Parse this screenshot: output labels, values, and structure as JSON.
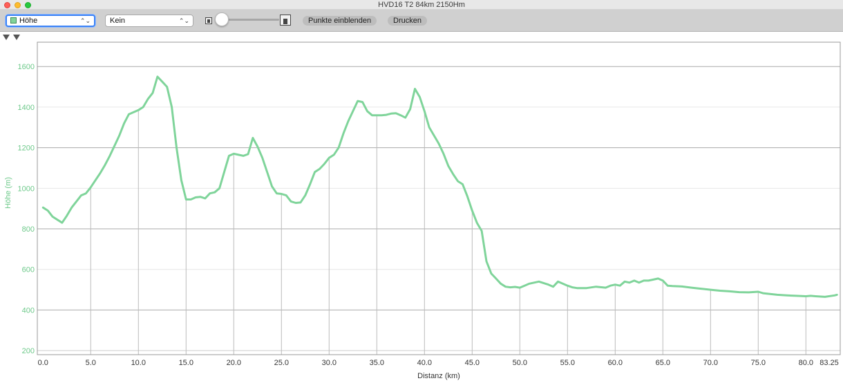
{
  "window": {
    "title": "HVD16 T2 84km 2150Hm"
  },
  "toolbar": {
    "left_select": "Höhe",
    "right_select": "Kein",
    "show_points_label": "Punkte einblenden",
    "print_label": "Drucken"
  },
  "icons": {
    "select_arrows": "⌃⌄"
  },
  "colors": {
    "series": "#7fd49a",
    "y_axis_text": "#6dc98a",
    "x_axis_text": "#333333",
    "grid": "#bbbbbb"
  },
  "chart_data": {
    "type": "line",
    "xlabel": "Distanz (km)",
    "ylabel": "Höhe (m)",
    "xlim": [
      -0.6,
      83.6
    ],
    "ylim": [
      180,
      1720
    ],
    "x_ticks": [
      0,
      5,
      10,
      15,
      20,
      25,
      30,
      35,
      40,
      45,
      50,
      55,
      60,
      65,
      70,
      75,
      80
    ],
    "x_tick_labels": [
      "0.0",
      "5.0",
      "10.0",
      "15.0",
      "20.0",
      "25.0",
      "30.0",
      "35.0",
      "40.0",
      "45.0",
      "50.0",
      "55.0",
      "60.0",
      "65.0",
      "70.0",
      "75.0",
      "80.0"
    ],
    "x_end_label": "83.25",
    "y_ticks": [
      200,
      400,
      600,
      800,
      1000,
      1200,
      1400,
      1600
    ],
    "y_tick_labels": [
      "200",
      "400",
      "600",
      "800",
      "1000",
      "1200",
      "1400",
      "1600"
    ],
    "grid": true,
    "series": [
      {
        "color": "#7fd49a",
        "x": [
          0,
          0.5,
          1,
          1.5,
          2,
          2.5,
          3,
          3.5,
          4,
          4.5,
          5,
          5.5,
          6,
          6.5,
          7,
          7.5,
          8,
          8.5,
          9,
          9.5,
          10,
          10.5,
          11,
          11.5,
          12,
          12.5,
          13,
          13.5,
          14,
          14.5,
          15,
          15.5,
          16,
          16.5,
          17,
          17.5,
          18,
          18.5,
          19,
          19.5,
          20,
          20.5,
          21,
          21.5,
          22,
          22.5,
          23,
          23.5,
          24,
          24.5,
          25,
          25.5,
          26,
          26.5,
          27,
          27.5,
          28,
          28.5,
          29,
          29.5,
          30,
          30.5,
          31,
          31.5,
          32,
          32.5,
          33,
          33.5,
          34,
          34.5,
          35,
          35.5,
          36,
          36.5,
          37,
          37.5,
          38,
          38.5,
          39,
          39.5,
          40,
          40.5,
          41,
          41.5,
          42,
          42.5,
          43,
          43.5,
          44,
          44.5,
          45,
          45.5,
          46,
          46.5,
          47,
          47.5,
          48,
          48.5,
          49,
          49.5,
          50,
          51,
          52,
          53,
          53.5,
          54,
          55,
          55.5,
          56,
          57,
          58,
          59,
          59.5,
          60,
          60.5,
          61,
          61.5,
          62,
          62.5,
          63,
          63.5,
          64,
          64.5,
          65,
          65.5,
          66,
          67,
          68,
          69,
          70,
          71,
          72,
          73,
          74,
          75,
          75.5,
          76,
          77,
          78,
          79,
          80,
          80.5,
          81,
          82,
          83,
          83.25
        ],
        "y": [
          905,
          890,
          860,
          845,
          830,
          865,
          905,
          935,
          965,
          975,
          1005,
          1040,
          1075,
          1115,
          1160,
          1210,
          1260,
          1320,
          1365,
          1375,
          1385,
          1400,
          1440,
          1470,
          1550,
          1525,
          1500,
          1400,
          1200,
          1040,
          945,
          945,
          955,
          958,
          950,
          975,
          980,
          1000,
          1080,
          1160,
          1170,
          1165,
          1160,
          1168,
          1248,
          1205,
          1150,
          1080,
          1010,
          975,
          972,
          965,
          935,
          928,
          930,
          965,
          1020,
          1080,
          1095,
          1120,
          1150,
          1165,
          1200,
          1270,
          1330,
          1380,
          1430,
          1425,
          1380,
          1360,
          1360,
          1360,
          1362,
          1368,
          1370,
          1360,
          1348,
          1390,
          1490,
          1450,
          1380,
          1300,
          1260,
          1220,
          1170,
          1110,
          1070,
          1035,
          1020,
          960,
          890,
          830,
          790,
          640,
          580,
          555,
          530,
          515,
          512,
          514,
          510,
          530,
          540,
          525,
          515,
          540,
          520,
          512,
          508,
          508,
          515,
          510,
          520,
          525,
          520,
          540,
          535,
          545,
          535,
          545,
          545,
          550,
          555,
          545,
          520,
          518,
          516,
          510,
          505,
          500,
          495,
          492,
          488,
          487,
          490,
          483,
          480,
          475,
          472,
          470,
          468,
          470,
          468,
          465,
          472,
          475
        ]
      }
    ]
  }
}
